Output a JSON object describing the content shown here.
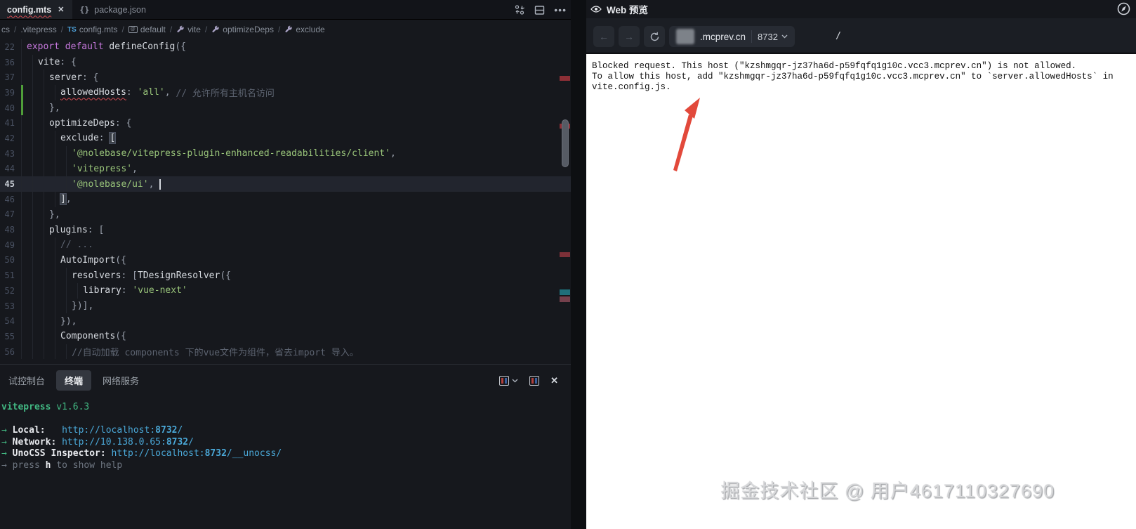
{
  "editor": {
    "tabs": [
      {
        "label": "config.mts",
        "active": true,
        "has_error": true
      },
      {
        "label": "package.json",
        "active": false,
        "icon": "{}"
      }
    ],
    "breadcrumb": [
      {
        "label": "cs",
        "icon": "none"
      },
      {
        "label": ".vitepress",
        "icon": "none"
      },
      {
        "label": "config.mts",
        "icon": "ts",
        "icon_text": "TS"
      },
      {
        "label": "default",
        "icon": "symbol"
      },
      {
        "label": "vite",
        "icon": "wrench"
      },
      {
        "label": "optimizeDeps",
        "icon": "wrench"
      },
      {
        "label": "exclude",
        "icon": "wrench"
      }
    ],
    "code_lines": [
      {
        "n": "22",
        "i": 0,
        "t": [
          [
            "kw",
            "export "
          ],
          [
            "kw",
            "default "
          ],
          [
            "id",
            "defineConfig"
          ],
          [
            "pn",
            "({"
          ]
        ]
      },
      {
        "n": "36",
        "i": 1,
        "t": [
          [
            "id",
            "vite"
          ],
          [
            "pn",
            ": {"
          ]
        ]
      },
      {
        "n": "37",
        "i": 2,
        "t": [
          [
            "id",
            "server"
          ],
          [
            "pn",
            ": {"
          ]
        ]
      },
      {
        "n": "39",
        "i": 3,
        "m": true,
        "t": [
          [
            "err",
            "allowedHosts"
          ],
          [
            "pn",
            ": "
          ],
          [
            "str",
            "'all'"
          ],
          [
            "pn",
            ", "
          ],
          [
            "cm",
            "// 允许所有主机名访问"
          ]
        ]
      },
      {
        "n": "40",
        "i": 2,
        "m": true,
        "t": [
          [
            "pn",
            "},"
          ]
        ]
      },
      {
        "n": "41",
        "i": 2,
        "t": [
          [
            "id",
            "optimizeDeps"
          ],
          [
            "pn",
            ": {"
          ]
        ]
      },
      {
        "n": "42",
        "i": 3,
        "t": [
          [
            "id",
            "exclude"
          ],
          [
            "pn",
            ": "
          ],
          [
            "br",
            "["
          ]
        ]
      },
      {
        "n": "43",
        "i": 4,
        "t": [
          [
            "str",
            "'@nolebase/vitepress-plugin-enhanced-readabilities/client'"
          ],
          [
            "pn",
            ","
          ]
        ]
      },
      {
        "n": "44",
        "i": 4,
        "t": [
          [
            "str",
            "'vitepress'"
          ],
          [
            "pn",
            ","
          ]
        ]
      },
      {
        "n": "45",
        "i": 4,
        "cur": true,
        "t": [
          [
            "str",
            "'@nolebase/ui'"
          ],
          [
            "pn",
            ", "
          ],
          [
            "cursor",
            ""
          ]
        ]
      },
      {
        "n": "46",
        "i": 3,
        "t": [
          [
            "br",
            "]"
          ],
          [
            "pn",
            ","
          ]
        ]
      },
      {
        "n": "47",
        "i": 2,
        "t": [
          [
            "pn",
            "},"
          ]
        ]
      },
      {
        "n": "48",
        "i": 2,
        "t": [
          [
            "id",
            "plugins"
          ],
          [
            "pn",
            ": ["
          ]
        ]
      },
      {
        "n": "49",
        "i": 3,
        "t": [
          [
            "cm",
            "// ..."
          ]
        ]
      },
      {
        "n": "50",
        "i": 3,
        "t": [
          [
            "id",
            "AutoImport"
          ],
          [
            "pn",
            "({"
          ]
        ]
      },
      {
        "n": "51",
        "i": 4,
        "t": [
          [
            "id",
            "resolvers"
          ],
          [
            "pn",
            ": ["
          ],
          [
            "id",
            "TDesignResolver"
          ],
          [
            "pn",
            "({"
          ]
        ]
      },
      {
        "n": "52",
        "i": 5,
        "t": [
          [
            "id",
            "library"
          ],
          [
            "pn",
            ": "
          ],
          [
            "str",
            "'vue-next'"
          ]
        ]
      },
      {
        "n": "53",
        "i": 4,
        "t": [
          [
            "pn",
            "})],"
          ]
        ]
      },
      {
        "n": "54",
        "i": 3,
        "t": [
          [
            "pn",
            "}),"
          ]
        ]
      },
      {
        "n": "55",
        "i": 3,
        "t": [
          [
            "id",
            "Components"
          ],
          [
            "pn",
            "({"
          ]
        ]
      },
      {
        "n": "56",
        "i": 4,
        "t": [
          [
            "cm",
            "//自动加载 components 下的vue文件为组件，省去import 导入。"
          ]
        ]
      }
    ]
  },
  "panel": {
    "tabs": [
      {
        "label": "试控制台",
        "active": false
      },
      {
        "label": "终端",
        "active": true
      },
      {
        "label": "网络服务",
        "active": false
      }
    ],
    "terminal_lines": [
      [
        [
          "gb",
          "vitepress "
        ],
        [
          "g",
          "v1.6.3"
        ]
      ],
      [],
      [
        [
          "g",
          "→ "
        ],
        [
          "w",
          "Local:"
        ],
        [
          "c",
          "   http://localhost:"
        ],
        [
          "cb",
          "8732"
        ],
        [
          "c",
          "/"
        ]
      ],
      [
        [
          "g",
          "→ "
        ],
        [
          "w",
          "Network:"
        ],
        [
          "c",
          " http://10.138.0.65:"
        ],
        [
          "cb",
          "8732"
        ],
        [
          "c",
          "/"
        ]
      ],
      [
        [
          "g",
          "→ "
        ],
        [
          "w",
          "UnoCSS Inspector:"
        ],
        [
          "c",
          " http://localhost:"
        ],
        [
          "cb",
          "8732"
        ],
        [
          "c",
          "/__unocss/"
        ]
      ],
      [
        [
          "d",
          "→ press "
        ],
        [
          "w",
          "h"
        ],
        [
          "d",
          " to show help"
        ]
      ]
    ]
  },
  "preview": {
    "title": "Web 预览",
    "url_host": ".mcprev.cn",
    "url_port": "8732",
    "url_path": "/",
    "error_lines": [
      "Blocked request. This host (\"kzshmgqr-jz37ha6d-p59fqfq1g10c.vcc3.mcprev.cn\") is not allowed.",
      "To allow this host, add \"kzshmgqr-jz37ha6d-p59fqfq1g10c.vcc3.mcprev.cn\" to `server.allowedHosts` in",
      "vite.config.js."
    ],
    "watermark": "掘金技术社区 @ 用户4617110327690"
  },
  "colors": {
    "annotation_arrow_red": "#e2493b",
    "vite_green": "#42b983",
    "url_cyan": "#4aa8d8",
    "error_squiggle_red": "#d14b52",
    "modified_gutter_green": "#4f9e39"
  }
}
